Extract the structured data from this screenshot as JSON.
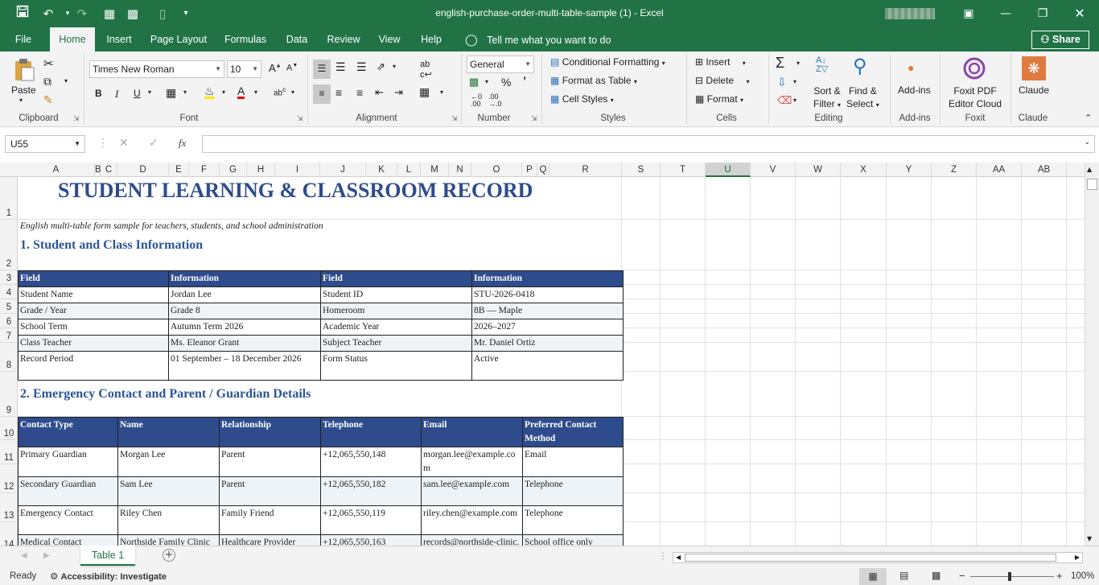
{
  "window": {
    "title": "english-purchase-order-multi-table-sample (1)  -  Excel",
    "qat_icons": [
      "save-icon",
      "undo-icon",
      "redo-icon",
      "touch-mode-icon",
      "form-icon",
      "customize-qat-icon"
    ]
  },
  "ribbon_tabs": [
    "File",
    "Home",
    "Insert",
    "Page Layout",
    "Formulas",
    "Data",
    "Review",
    "View",
    "Help"
  ],
  "active_tab": "Home",
  "tell_me": "Tell me what you want to do",
  "share_label": "Share",
  "ribbon": {
    "clipboard": {
      "paste": "Paste",
      "label": "Clipboard"
    },
    "font": {
      "name": "Times New Roman",
      "size": "10",
      "bold": "B",
      "italic": "I",
      "underline": "U",
      "label": "Font"
    },
    "alignment": {
      "label": "Alignment"
    },
    "number": {
      "format": "General",
      "percent": "%",
      "comma": "’",
      "label": "Number"
    },
    "styles": {
      "conditional": "Conditional Formatting",
      "format_table": "Format as Table",
      "cell_styles": "Cell Styles",
      "label": "Styles"
    },
    "cells": {
      "insert": "Insert",
      "delete": "Delete",
      "format": "Format",
      "label": "Cells"
    },
    "editing": {
      "sort1": "Sort &",
      "sort2": "Filter",
      "find1": "Find &",
      "find2": "Select",
      "label": "Editing"
    },
    "addins": {
      "btn": "Add-ins",
      "label": "Add-ins"
    },
    "foxit": {
      "btn1": "Foxit PDF",
      "btn2": "Editor Cloud",
      "label": "Foxit"
    },
    "claude": {
      "btn": "Claude",
      "label": "Claude"
    }
  },
  "formula_bar": {
    "name_box": "U55",
    "fx": "fx",
    "value": ""
  },
  "columns": [
    "A",
    "B",
    "C",
    "D",
    "E",
    "F",
    "G",
    "H",
    "I",
    "J",
    "K",
    "L",
    "M",
    "N",
    "O",
    "P",
    "Q",
    "R",
    "S",
    "T",
    "U",
    "V",
    "W",
    "X",
    "Y",
    "Z",
    "AA",
    "AB"
  ],
  "selected_column": "U",
  "rows": [
    "1",
    "2",
    "3",
    "4",
    "5",
    "6",
    "7",
    "8",
    "9",
    "10",
    "11",
    "12",
    "13",
    "14"
  ],
  "sheet": {
    "title": "STUDENT LEARNING & CLASSROOM RECORD",
    "subtitle": "English multi-table form sample for teachers, students, and school administration",
    "section1": "1. Student and Class Information",
    "table1": {
      "headers": [
        "Field",
        "Information",
        "Field",
        "Information"
      ],
      "rows": [
        [
          "Student Name",
          "Jordan Lee",
          "Student ID",
          "STU-2026-0418"
        ],
        [
          "Grade / Year",
          "Grade 8",
          "Homeroom",
          "8B — Maple"
        ],
        [
          "School Term",
          "Autumn Term 2026",
          "Academic Year",
          "2026–2027"
        ],
        [
          "Class Teacher",
          "Ms. Eleanor Grant",
          "Subject Teacher",
          "Mr. Daniel Ortiz"
        ],
        [
          "Record Period",
          "01 September – 18 December 2026",
          "Form Status",
          "Active"
        ]
      ]
    },
    "section2": "2. Emergency Contact and Parent / Guardian Details",
    "table2": {
      "headers": [
        "Contact Type",
        "Name",
        "Relationship",
        "Telephone",
        "Email",
        "Preferred Contact Method"
      ],
      "rows": [
        [
          "Primary Guardian",
          "Morgan Lee",
          "Parent",
          "+12,065,550,148",
          "morgan.lee@example.com",
          "Email"
        ],
        [
          "Secondary Guardian",
          "Sam Lee",
          "Parent",
          "+12,065,550,182",
          "sam.lee@example.com",
          "Telephone"
        ],
        [
          "Emergency Contact",
          "Riley Chen",
          "Family Friend",
          "+12,065,550,119",
          "riley.chen@example.com",
          "Telephone"
        ],
        [
          "Medical Contact",
          "Northside Family Clinic",
          "Healthcare Provider",
          "+12,065,550,163",
          "records@northside-clinic.example",
          "School office only"
        ]
      ]
    }
  },
  "sheet_tabs": [
    "Table 1"
  ],
  "status": {
    "ready": "Ready",
    "accessibility": "Accessibility: Investigate",
    "zoom": "100%"
  }
}
